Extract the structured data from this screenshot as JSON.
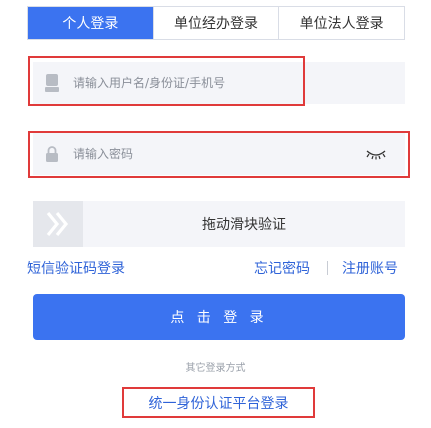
{
  "tabs": [
    {
      "label": "个人登录",
      "active": true
    },
    {
      "label": "单位经办登录",
      "active": false
    },
    {
      "label": "单位法人登录",
      "active": false
    }
  ],
  "username": {
    "placeholder": "请输入用户名/身份证/手机号",
    "value": "",
    "icon": "user-icon"
  },
  "password": {
    "placeholder": "请输入密码",
    "value": "",
    "icon": "lock-icon",
    "toggle_icon": "eye-closed-icon"
  },
  "slider": {
    "label": "拖动滑块验证",
    "handle_icon": "double-chevron-right-icon"
  },
  "links": {
    "sms_login": "短信验证码登录",
    "forgot_password": "忘记密码",
    "register": "注册账号"
  },
  "login_button": "点 击 登 录",
  "other_methods": "其它登录方式",
  "unified_login": "统一身份认证平台登录",
  "colors": {
    "primary": "#3b73f0",
    "link": "#2f63d8",
    "field_bg": "#f4f5f9",
    "highlight": "#e03a3a"
  }
}
